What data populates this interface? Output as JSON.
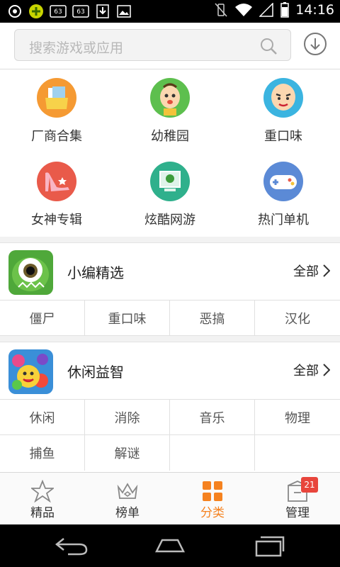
{
  "status_bar": {
    "time": "14:16",
    "left_icons": [
      "notification-icon",
      "app-icon",
      "badge-63-icon",
      "badge-63-icon",
      "download-icon",
      "image-icon"
    ],
    "right_icons": [
      "vibrate-icon",
      "wifi-icon",
      "signal-icon",
      "battery-icon"
    ],
    "badges": [
      "63",
      "63"
    ]
  },
  "search": {
    "placeholder": "搜索游戏或应用"
  },
  "categories": [
    {
      "label": "厂商合集",
      "icon": "folder-icon",
      "color": "#f59a33"
    },
    {
      "label": "幼稚园",
      "icon": "kid-face-icon",
      "color": "#5dbf4e"
    },
    {
      "label": "重口味",
      "icon": "bald-face-icon",
      "color": "#3bb4e0"
    },
    {
      "label": "女神专辑",
      "icon": "high-heel-icon",
      "color": "#e95a4a"
    },
    {
      "label": "炫酷网游",
      "icon": "computer-icon",
      "color": "#2fb08c"
    },
    {
      "label": "热门单机",
      "icon": "gamepad-icon",
      "color": "#5b8ad6"
    }
  ],
  "sections": [
    {
      "title": "小编精选",
      "all_label": "全部",
      "thumb": "monster-eye-icon",
      "tags": [
        [
          "僵尸",
          "重口味",
          "恶搞",
          "汉化"
        ]
      ]
    },
    {
      "title": "休闲益智",
      "all_label": "全部",
      "thumb": "candy-game-icon",
      "tags": [
        [
          "休闲",
          "消除",
          "音乐",
          "物理"
        ],
        [
          "捕鱼",
          "解谜",
          "",
          ""
        ]
      ]
    }
  ],
  "bottom_nav": [
    {
      "label": "精品",
      "icon": "star-icon",
      "active": false
    },
    {
      "label": "榜单",
      "icon": "crown-icon",
      "active": false
    },
    {
      "label": "分类",
      "icon": "grid-icon",
      "active": true
    },
    {
      "label": "管理",
      "icon": "manage-icon",
      "active": false
    }
  ],
  "manage_badge": "21",
  "colors": {
    "accent": "#f5821f",
    "badge": "#e8453c"
  }
}
